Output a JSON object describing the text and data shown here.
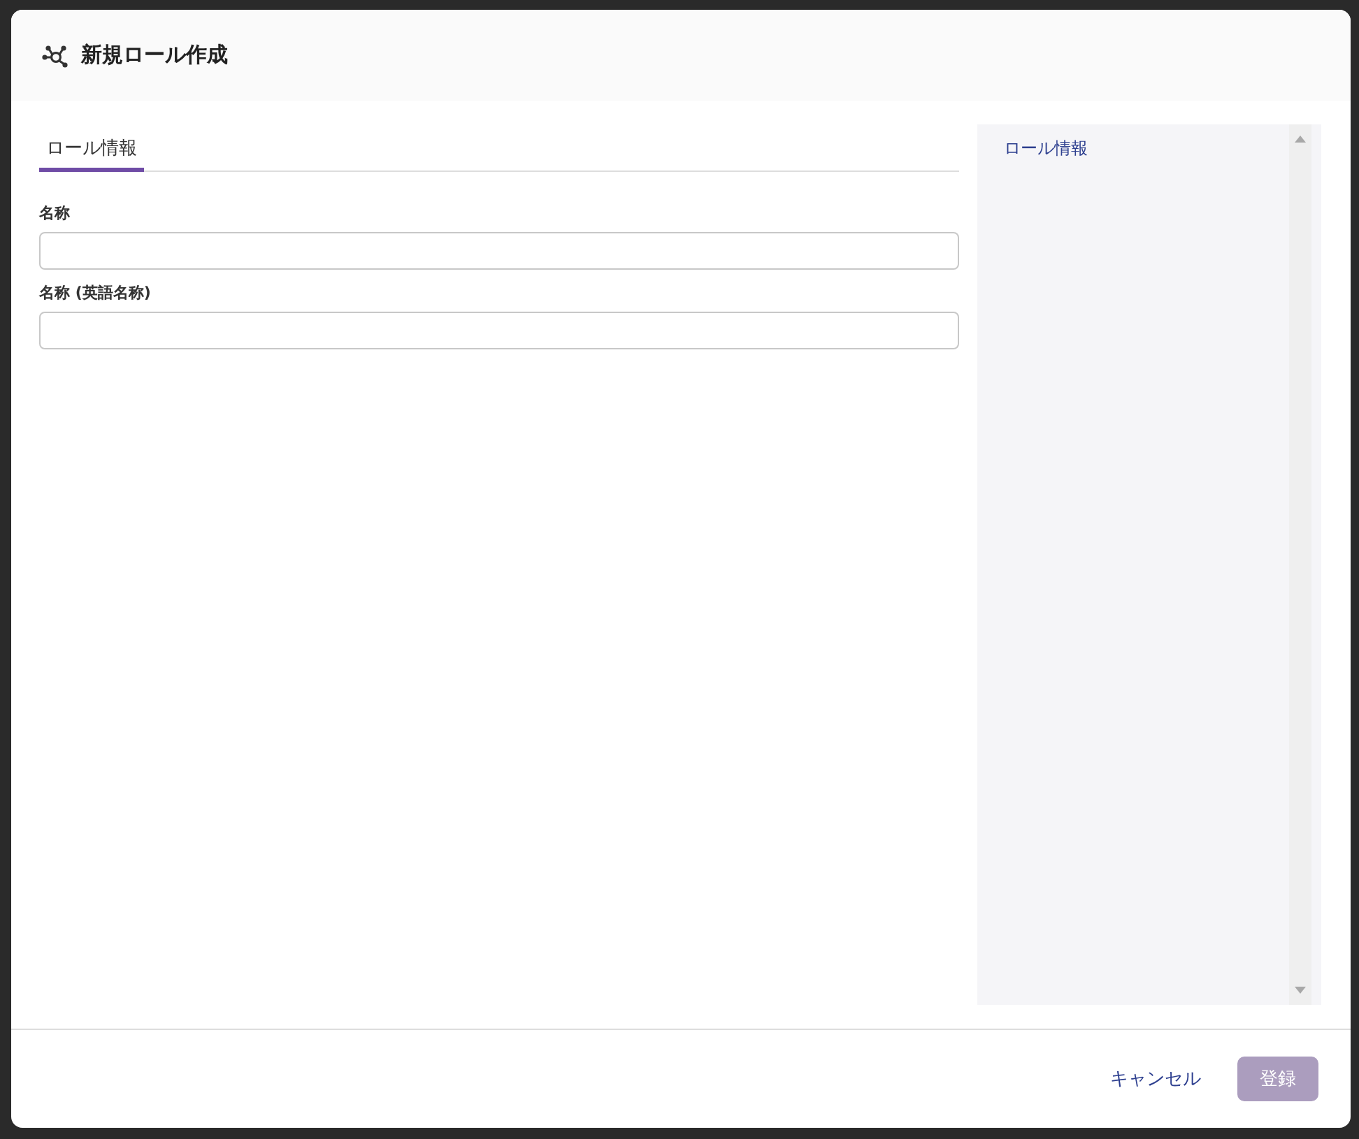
{
  "dialog": {
    "title": "新規ロール作成"
  },
  "tabs": [
    {
      "label": "ロール情報",
      "selected": true
    }
  ],
  "fields": [
    {
      "label": "名称"
    },
    {
      "label": "名称 (英語名称)"
    }
  ],
  "side_nav": {
    "items": [
      {
        "label": "ロール情報"
      }
    ]
  },
  "footer": {
    "cancel": {
      "label": "キャンセル"
    },
    "submit": {
      "label": "登録",
      "disabled": true
    }
  }
}
